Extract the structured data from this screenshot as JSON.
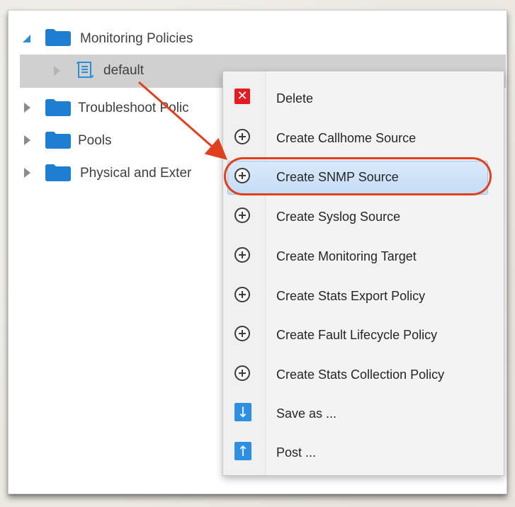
{
  "tree": {
    "items": [
      {
        "label": "Monitoring Policies",
        "expanded": true,
        "icon": "folder-icon"
      },
      {
        "label": "default",
        "selected": true,
        "icon": "policy-document-icon"
      },
      {
        "label": "Troubleshoot Polic",
        "icon": "folder-icon"
      },
      {
        "label": "Pools",
        "icon": "folder-icon"
      },
      {
        "label": "Physical and Exter",
        "icon": "folder-icon"
      }
    ]
  },
  "context_menu": {
    "items": [
      {
        "label": "Delete",
        "icon": "delete-icon"
      },
      {
        "label": "Create Callhome Source",
        "icon": "plus-circle-icon"
      },
      {
        "label": "Create SNMP Source",
        "icon": "plus-circle-icon",
        "highlighted": true
      },
      {
        "label": "Create Syslog Source",
        "icon": "plus-circle-icon"
      },
      {
        "label": "Create Monitoring Target",
        "icon": "plus-circle-icon"
      },
      {
        "label": "Create Stats Export Policy",
        "icon": "plus-circle-icon"
      },
      {
        "label": "Create Fault Lifecycle Policy",
        "icon": "plus-circle-icon"
      },
      {
        "label": "Create Stats Collection Policy",
        "icon": "plus-circle-icon"
      },
      {
        "label": "Save as ...",
        "icon": "download-arrow-icon"
      },
      {
        "label": "Post ...",
        "icon": "upload-arrow-icon"
      }
    ]
  },
  "colors": {
    "folder": "#1f7ed0",
    "annotation": "#e0401e",
    "highlight": "#c5dcf6",
    "delete": "#e51b23",
    "arrow_icon": "#2e8fe0"
  }
}
